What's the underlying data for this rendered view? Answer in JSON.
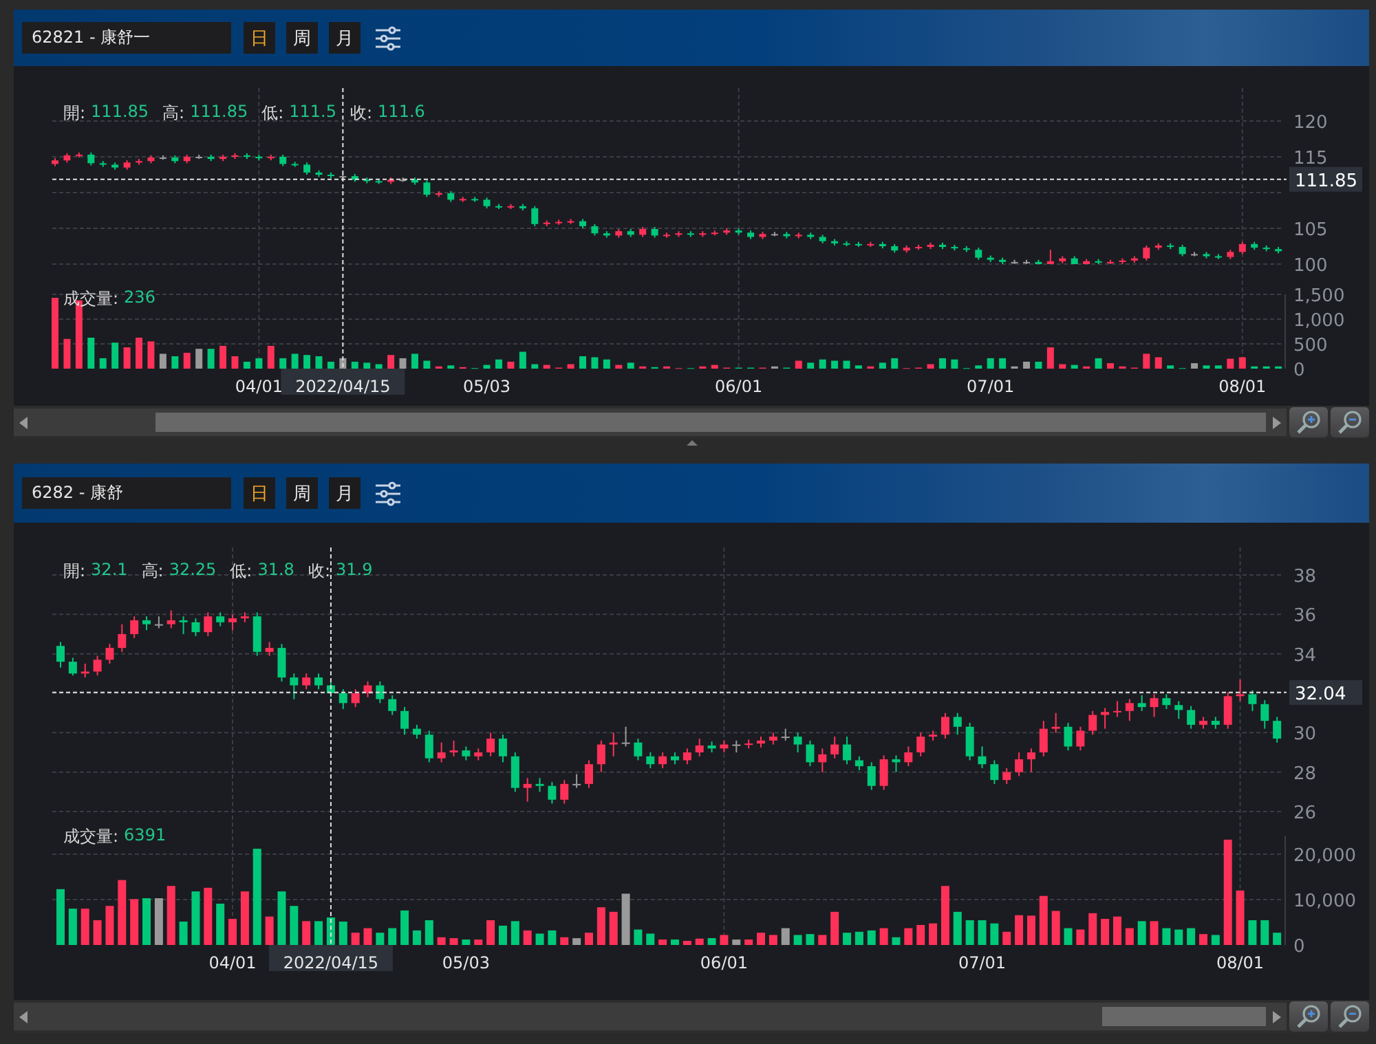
{
  "panels": [
    {
      "symbol": "62821 - 康舒一",
      "periods": [
        {
          "label": "日",
          "selected": true
        },
        {
          "label": "周",
          "selected": false
        },
        {
          "label": "月",
          "selected": false
        }
      ],
      "info": [
        {
          "label": "開:",
          "value": "111.85"
        },
        {
          "label": "高:",
          "value": "111.85"
        },
        {
          "label": "低:",
          "value": "111.5"
        },
        {
          "label": "收:",
          "value": "111.6"
        }
      ],
      "volume_info": {
        "label": "成交量:",
        "value": "236"
      },
      "price_chart": {
        "chart_data": {
          "type": "candlestick",
          "ylim": [
            100,
            120
          ],
          "yticks": [
            100,
            105,
            115,
            120
          ],
          "categories": [
            null,
            null,
            null,
            null,
            null,
            null,
            null,
            null,
            null,
            null,
            null,
            null,
            null,
            null,
            null,
            null,
            null,
            null,
            null,
            null,
            null,
            null,
            null,
            null,
            null,
            null,
            null,
            null,
            null,
            null,
            null,
            null,
            null,
            null,
            null,
            null,
            null,
            null,
            null,
            null,
            null,
            null,
            null,
            null,
            null,
            null,
            null,
            null,
            null,
            null,
            null,
            null,
            null,
            null,
            null,
            null,
            null,
            null,
            null,
            null,
            null,
            null,
            null,
            null,
            null,
            null,
            null,
            null,
            null,
            null,
            null,
            null,
            null,
            null,
            null,
            null,
            null,
            null,
            null,
            null,
            null,
            null,
            null,
            null,
            null,
            null,
            null,
            null,
            null,
            null,
            null,
            null,
            null,
            null,
            null,
            null,
            null,
            null,
            null,
            null,
            null,
            null,
            null
          ],
          "ref_lines": [
            {
              "axis": "y",
              "value": 111.85,
              "label": "111.85"
            }
          ],
          "ohlc": [
            [
              114.0,
              114.8,
              113.7,
              114.5
            ],
            [
              114.5,
              115.5,
              114.2,
              115.2
            ],
            [
              115.2,
              115.6,
              114.9,
              115.3
            ],
            [
              115.3,
              115.6,
              113.8,
              114.1
            ],
            [
              114.1,
              114.4,
              113.6,
              113.9
            ],
            [
              113.9,
              114.2,
              113.2,
              113.5
            ],
            [
              113.5,
              114.5,
              113.2,
              114.2
            ],
            [
              114.2,
              114.7,
              113.9,
              114.4
            ],
            [
              114.4,
              115.2,
              114.1,
              114.9
            ],
            [
              114.9,
              115.2,
              114.6,
              114.9
            ],
            [
              114.9,
              115.2,
              114.1,
              114.4
            ],
            [
              114.4,
              115.3,
              114.1,
              115.0
            ],
            [
              115.0,
              115.3,
              114.7,
              115.0
            ],
            [
              115.0,
              115.3,
              114.4,
              114.7
            ],
            [
              114.7,
              115.3,
              114.4,
              115.0
            ],
            [
              115.0,
              115.5,
              114.7,
              115.2
            ],
            [
              115.2,
              115.5,
              114.7,
              115.0
            ],
            [
              115.0,
              115.3,
              114.5,
              114.8
            ],
            [
              114.8,
              115.3,
              114.5,
              115.0
            ],
            [
              115.0,
              115.3,
              113.7,
              114.0
            ],
            [
              114.0,
              114.3,
              113.6,
              113.9
            ],
            [
              113.9,
              114.2,
              112.5,
              112.8
            ],
            [
              112.8,
              113.1,
              112.2,
              112.5
            ],
            [
              112.5,
              112.8,
              112.0,
              112.3
            ],
            [
              112.3,
              112.6,
              112.0,
              112.3
            ],
            [
              112.3,
              112.6,
              111.5,
              111.8
            ],
            [
              111.8,
              112.1,
              111.3,
              111.6
            ],
            [
              111.6,
              111.9,
              111.2,
              111.5
            ],
            [
              111.5,
              112.1,
              111.2,
              111.8
            ],
            [
              111.8,
              112.1,
              111.5,
              111.8
            ],
            [
              111.8,
              112.1,
              111.1,
              111.4
            ],
            [
              111.4,
              111.7,
              109.4,
              109.7
            ],
            [
              109.7,
              110.2,
              109.4,
              109.9
            ],
            [
              109.9,
              110.2,
              108.7,
              109.0
            ],
            [
              109.0,
              109.4,
              108.7,
              109.1
            ],
            [
              109.1,
              109.4,
              108.7,
              109.0
            ],
            [
              109.0,
              109.3,
              107.8,
              108.1
            ],
            [
              108.1,
              108.4,
              107.7,
              108.0
            ],
            [
              108.0,
              108.4,
              107.7,
              108.1
            ],
            [
              108.1,
              108.4,
              107.5,
              107.8
            ],
            [
              107.8,
              108.1,
              105.3,
              105.6
            ],
            [
              105.6,
              106.1,
              105.3,
              105.8
            ],
            [
              105.8,
              106.2,
              105.5,
              105.9
            ],
            [
              105.9,
              106.3,
              105.6,
              106.0
            ],
            [
              106.0,
              106.3,
              105.0,
              105.3
            ],
            [
              105.3,
              105.6,
              104.0,
              104.3
            ],
            [
              104.3,
              104.6,
              103.7,
              104.0
            ],
            [
              104.0,
              104.9,
              103.7,
              104.6
            ],
            [
              104.6,
              104.9,
              103.8,
              104.1
            ],
            [
              104.1,
              105.2,
              103.8,
              104.9
            ],
            [
              104.9,
              105.2,
              103.7,
              104.0
            ],
            [
              104.0,
              104.4,
              103.7,
              104.1
            ],
            [
              104.1,
              104.6,
              103.8,
              104.3
            ],
            [
              104.3,
              104.6,
              103.8,
              104.1
            ],
            [
              104.1,
              104.6,
              103.8,
              104.3
            ],
            [
              104.3,
              104.7,
              104.0,
              104.4
            ],
            [
              104.4,
              105.0,
              104.1,
              104.7
            ],
            [
              104.7,
              105.0,
              104.1,
              104.4
            ],
            [
              104.4,
              104.7,
              103.5,
              103.8
            ],
            [
              103.8,
              104.5,
              103.5,
              104.2
            ],
            [
              104.2,
              104.5,
              103.9,
              104.2
            ],
            [
              104.2,
              104.5,
              103.6,
              103.9
            ],
            [
              103.9,
              104.4,
              103.6,
              104.1
            ],
            [
              104.1,
              104.4,
              103.5,
              103.8
            ],
            [
              103.8,
              104.1,
              102.9,
              103.2
            ],
            [
              103.2,
              103.5,
              102.6,
              102.9
            ],
            [
              102.9,
              103.2,
              102.5,
              102.8
            ],
            [
              102.8,
              103.1,
              102.4,
              102.7
            ],
            [
              102.7,
              103.1,
              102.4,
              102.8
            ],
            [
              102.8,
              103.1,
              102.2,
              102.5
            ],
            [
              102.5,
              102.8,
              101.6,
              101.9
            ],
            [
              101.9,
              102.6,
              101.6,
              102.3
            ],
            [
              102.3,
              102.7,
              102.0,
              102.4
            ],
            [
              102.4,
              103.0,
              102.1,
              102.7
            ],
            [
              102.7,
              103.0,
              102.1,
              102.4
            ],
            [
              102.4,
              102.7,
              101.9,
              102.2
            ],
            [
              102.2,
              102.5,
              101.7,
              102.0
            ],
            [
              102.0,
              102.3,
              100.6,
              100.9
            ],
            [
              100.9,
              101.2,
              100.3,
              100.6
            ],
            [
              100.6,
              100.9,
              100.0,
              100.3
            ],
            [
              100.3,
              100.6,
              100.0,
              100.3
            ],
            [
              100.3,
              100.6,
              100.0,
              100.3
            ],
            [
              100.3,
              100.6,
              100.0,
              100.0
            ],
            [
              100.0,
              102.0,
              100.0,
              100.4
            ],
            [
              100.4,
              101.1,
              100.1,
              100.8
            ],
            [
              100.8,
              101.1,
              100.0,
              100.0
            ],
            [
              100.0,
              100.7,
              100.0,
              100.4
            ],
            [
              100.4,
              100.7,
              100.0,
              100.2
            ],
            [
              100.2,
              100.6,
              100.0,
              100.3
            ],
            [
              100.3,
              100.8,
              100.0,
              100.5
            ],
            [
              100.5,
              101.1,
              100.2,
              100.8
            ],
            [
              100.8,
              102.6,
              100.5,
              102.3
            ],
            [
              102.3,
              102.9,
              102.0,
              102.6
            ],
            [
              102.6,
              102.9,
              102.1,
              102.4
            ],
            [
              102.4,
              102.7,
              101.1,
              101.4
            ],
            [
              101.4,
              101.7,
              101.1,
              101.4
            ],
            [
              101.4,
              101.7,
              100.8,
              101.1
            ],
            [
              101.1,
              101.4,
              100.7,
              101.0
            ],
            [
              101.0,
              102.0,
              100.7,
              101.7
            ],
            [
              101.7,
              103.1,
              101.4,
              102.8
            ],
            [
              102.8,
              103.1,
              102.0,
              102.3
            ],
            [
              102.3,
              102.6,
              101.8,
              102.1
            ],
            [
              102.1,
              102.4,
              101.5,
              101.8
            ]
          ]
        }
      },
      "volume_chart": {
        "chart_data": {
          "type": "bar",
          "categories": [
            null,
            null,
            null,
            null,
            null,
            null,
            null,
            null,
            null,
            null,
            null,
            null,
            null,
            null,
            null,
            null,
            null,
            "04/01",
            null,
            null,
            null,
            null,
            null,
            null,
            "2022/04/15",
            null,
            null,
            null,
            null,
            null,
            null,
            null,
            null,
            null,
            null,
            null,
            "05/03",
            null,
            null,
            null,
            null,
            null,
            null,
            null,
            null,
            null,
            null,
            null,
            null,
            null,
            null,
            null,
            null,
            null,
            null,
            null,
            null,
            "06/01",
            null,
            null,
            null,
            null,
            null,
            null,
            null,
            null,
            null,
            null,
            null,
            null,
            null,
            null,
            null,
            null,
            null,
            null,
            null,
            null,
            "07/01",
            null,
            null,
            null,
            null,
            null,
            null,
            null,
            null,
            null,
            null,
            null,
            null,
            null,
            null,
            null,
            null,
            null,
            null,
            null,
            null,
            "08/01",
            null,
            null,
            null
          ],
          "ref_lines": [
            {
              "axis": "x",
              "value": "2022/04/15"
            }
          ],
          "yticks": [
            {
              "value": 0,
              "label": "0"
            },
            {
              "value": 500,
              "label": "500"
            },
            {
              "value": 1000,
              "label": "1,000"
            },
            {
              "value": 1500,
              "label": "1,500"
            }
          ],
          "ylim": [
            0,
            1500
          ],
          "values": [
            1430,
            600,
            1380,
            625,
            210,
            525,
            430,
            625,
            550,
            300,
            250,
            320,
            400,
            400,
            460,
            250,
            140,
            210,
            460,
            210,
            300,
            275,
            250,
            140,
            210,
            140,
            120,
            90,
            275,
            210,
            300,
            160,
            45,
            65,
            30,
            10,
            75,
            185,
            140,
            340,
            90,
            75,
            20,
            90,
            250,
            230,
            185,
            75,
            120,
            45,
            30,
            45,
            10,
            10,
            45,
            75,
            20,
            20,
            20,
            20,
            45,
            20,
            160,
            120,
            185,
            160,
            160,
            65,
            45,
            120,
            210,
            10,
            20,
            90,
            210,
            185,
            10,
            65,
            210,
            210,
            45,
            140,
            140,
            430,
            90,
            75,
            45,
            210,
            110,
            45,
            20,
            300,
            230,
            65,
            10,
            110,
            65,
            65,
            200,
            230,
            45,
            45,
            45
          ]
        }
      }
    },
    {
      "symbol": "6282 - 康舒",
      "periods": [
        {
          "label": "日",
          "selected": true
        },
        {
          "label": "周",
          "selected": false
        },
        {
          "label": "月",
          "selected": false
        }
      ],
      "info": [
        {
          "label": "開:",
          "value": "32.1"
        },
        {
          "label": "高:",
          "value": "32.25"
        },
        {
          "label": "低:",
          "value": "31.8"
        },
        {
          "label": "收:",
          "value": "31.9"
        }
      ],
      "volume_info": {
        "label": "成交量:",
        "value": "6391"
      },
      "price_chart": {
        "chart_data": {
          "type": "candlestick",
          "ylim": [
            26,
            38
          ],
          "yticks": [
            26,
            28,
            30,
            34,
            36,
            38
          ],
          "categories": [
            null,
            null,
            null,
            null,
            null,
            null,
            null,
            null,
            null,
            null,
            null,
            null,
            null,
            null,
            null,
            null,
            null,
            null,
            null,
            null,
            null,
            null,
            null,
            null,
            null,
            null,
            null,
            null,
            null,
            null,
            null,
            null,
            null,
            null,
            null,
            null,
            null,
            null,
            null,
            null,
            null,
            null,
            null,
            null,
            null,
            null,
            null,
            null,
            null,
            null,
            null,
            null,
            null,
            null,
            null,
            null,
            null,
            null,
            null,
            null,
            null,
            null,
            null,
            null,
            null,
            null,
            null,
            null,
            null,
            null,
            null,
            null,
            null,
            null,
            null,
            null,
            null,
            null,
            null,
            null,
            null,
            null,
            null,
            null,
            null,
            null,
            null,
            null,
            null,
            null,
            null,
            null,
            null,
            null,
            null,
            null,
            null,
            null,
            null,
            null
          ],
          "ref_lines": [
            {
              "axis": "y",
              "value": 32.04,
              "label": "32.04"
            }
          ],
          "ohlc": [
            [
              34.4,
              34.6,
              33.3,
              33.6
            ],
            [
              33.6,
              33.8,
              32.9,
              33.0
            ],
            [
              33.0,
              33.5,
              32.8,
              33.1
            ],
            [
              33.1,
              33.9,
              32.9,
              33.7
            ],
            [
              33.7,
              34.5,
              33.5,
              34.3
            ],
            [
              34.3,
              35.5,
              34.1,
              35.0
            ],
            [
              35.0,
              35.9,
              34.8,
              35.7
            ],
            [
              35.7,
              35.9,
              35.2,
              35.5
            ],
            [
              35.5,
              35.9,
              35.3,
              35.5
            ],
            [
              35.5,
              36.2,
              35.3,
              35.7
            ],
            [
              35.7,
              35.9,
              35.0,
              35.6
            ],
            [
              35.6,
              35.8,
              34.9,
              35.1
            ],
            [
              35.1,
              36.1,
              34.9,
              35.9
            ],
            [
              35.9,
              36.1,
              35.4,
              35.6
            ],
            [
              35.6,
              36.0,
              35.2,
              35.8
            ],
            [
              35.8,
              36.1,
              35.6,
              35.9
            ],
            [
              35.9,
              36.1,
              33.9,
              34.1
            ],
            [
              34.1,
              34.6,
              33.9,
              34.3
            ],
            [
              34.3,
              34.5,
              32.6,
              32.8
            ],
            [
              32.8,
              33.0,
              31.7,
              32.4
            ],
            [
              32.4,
              33.0,
              32.2,
              32.8
            ],
            [
              32.8,
              33.0,
              32.2,
              32.4
            ],
            [
              32.4,
              32.6,
              31.8,
              32.0
            ],
            [
              32.0,
              32.2,
              31.2,
              31.5
            ],
            [
              31.5,
              32.2,
              31.3,
              32.0
            ],
            [
              32.0,
              32.6,
              31.8,
              32.4
            ],
            [
              32.4,
              32.6,
              31.5,
              31.7
            ],
            [
              31.7,
              31.9,
              30.9,
              31.1
            ],
            [
              31.1,
              31.3,
              29.9,
              30.2
            ],
            [
              30.2,
              30.4,
              29.7,
              29.9
            ],
            [
              29.9,
              30.1,
              28.5,
              28.7
            ],
            [
              28.7,
              29.5,
              28.5,
              29.0
            ],
            [
              29.0,
              29.6,
              28.8,
              29.1
            ],
            [
              29.1,
              29.3,
              28.6,
              28.8
            ],
            [
              28.8,
              29.2,
              28.6,
              29.0
            ],
            [
              29.0,
              30.0,
              28.8,
              29.7
            ],
            [
              29.7,
              29.9,
              28.5,
              28.8
            ],
            [
              28.8,
              29.0,
              27.0,
              27.2
            ],
            [
              27.2,
              27.7,
              26.5,
              27.4
            ],
            [
              27.4,
              27.7,
              27.0,
              27.3
            ],
            [
              27.3,
              27.5,
              26.4,
              26.6
            ],
            [
              26.6,
              27.6,
              26.4,
              27.4
            ],
            [
              27.4,
              27.9,
              27.2,
              27.4
            ],
            [
              27.4,
              28.6,
              27.2,
              28.4
            ],
            [
              28.4,
              29.6,
              28.0,
              29.4
            ],
            [
              29.4,
              30.0,
              28.8,
              29.5
            ],
            [
              29.5,
              30.3,
              29.3,
              29.5
            ],
            [
              29.5,
              29.7,
              28.6,
              28.8
            ],
            [
              28.8,
              29.0,
              28.2,
              28.4
            ],
            [
              28.4,
              29.0,
              28.2,
              28.8
            ],
            [
              28.8,
              29.0,
              28.4,
              28.6
            ],
            [
              28.6,
              29.2,
              28.4,
              29.0
            ],
            [
              29.0,
              29.7,
              28.8,
              29.35
            ],
            [
              29.35,
              29.55,
              29.0,
              29.2
            ],
            [
              29.2,
              29.6,
              29.0,
              29.4
            ],
            [
              29.4,
              29.6,
              29.0,
              29.4
            ],
            [
              29.4,
              29.65,
              29.2,
              29.45
            ],
            [
              29.45,
              29.8,
              29.25,
              29.6
            ],
            [
              29.6,
              30.0,
              29.4,
              29.8
            ],
            [
              29.8,
              30.2,
              29.6,
              29.8
            ],
            [
              29.8,
              30.0,
              29.0,
              29.4
            ],
            [
              29.4,
              29.6,
              28.3,
              28.5
            ],
            [
              28.5,
              29.2,
              28.0,
              28.9
            ],
            [
              28.9,
              29.8,
              28.7,
              29.4
            ],
            [
              29.4,
              29.8,
              28.4,
              28.6
            ],
            [
              28.6,
              28.8,
              28.1,
              28.3
            ],
            [
              28.3,
              28.5,
              27.1,
              27.3
            ],
            [
              27.3,
              28.85,
              27.1,
              28.65
            ],
            [
              28.65,
              28.85,
              28.0,
              28.5
            ],
            [
              28.5,
              29.3,
              28.3,
              29.0
            ],
            [
              29.0,
              30.0,
              28.8,
              29.8
            ],
            [
              29.8,
              30.1,
              29.6,
              29.9
            ],
            [
              29.9,
              31.0,
              29.7,
              30.8
            ],
            [
              30.8,
              31.0,
              29.9,
              30.3
            ],
            [
              30.3,
              30.5,
              28.6,
              28.8
            ],
            [
              28.8,
              29.3,
              28.2,
              28.4
            ],
            [
              28.4,
              28.6,
              27.4,
              27.6
            ],
            [
              27.6,
              28.2,
              27.4,
              28.0
            ],
            [
              28.0,
              29.0,
              27.8,
              28.65
            ],
            [
              28.65,
              29.2,
              28.0,
              29.0
            ],
            [
              29.0,
              30.6,
              28.8,
              30.2
            ],
            [
              30.2,
              31.0,
              30.0,
              30.3
            ],
            [
              30.3,
              30.5,
              29.1,
              29.3
            ],
            [
              29.3,
              30.3,
              29.1,
              30.1
            ],
            [
              30.1,
              31.1,
              29.9,
              30.9
            ],
            [
              30.9,
              31.25,
              30.2,
              31.05
            ],
            [
              31.05,
              31.6,
              30.8,
              31.1
            ],
            [
              31.1,
              31.7,
              30.6,
              31.5
            ],
            [
              31.5,
              31.9,
              31.1,
              31.3
            ],
            [
              31.3,
              31.95,
              30.8,
              31.75
            ],
            [
              31.75,
              31.95,
              31.2,
              31.4
            ],
            [
              31.4,
              31.6,
              30.7,
              31.15
            ],
            [
              31.15,
              31.35,
              30.2,
              30.4
            ],
            [
              30.4,
              30.8,
              30.2,
              30.6
            ],
            [
              30.6,
              30.8,
              30.2,
              30.4
            ],
            [
              30.4,
              32.05,
              30.2,
              31.85
            ],
            [
              31.85,
              32.7,
              31.6,
              31.95
            ],
            [
              31.95,
              32.15,
              31.1,
              31.45
            ],
            [
              31.45,
              31.65,
              30.2,
              30.6
            ],
            [
              30.6,
              30.8,
              29.5,
              29.7
            ]
          ]
        }
      },
      "volume_chart": {
        "chart_data": {
          "type": "bar",
          "categories": [
            null,
            null,
            null,
            null,
            null,
            null,
            null,
            null,
            null,
            null,
            null,
            null,
            null,
            null,
            "04/01",
            null,
            null,
            null,
            null,
            null,
            null,
            null,
            "2022/04/15",
            null,
            null,
            null,
            null,
            null,
            null,
            null,
            null,
            null,
            null,
            "05/03",
            null,
            null,
            null,
            null,
            null,
            null,
            null,
            null,
            null,
            null,
            null,
            null,
            null,
            null,
            null,
            null,
            null,
            null,
            null,
            null,
            "06/01",
            null,
            null,
            null,
            null,
            null,
            null,
            null,
            null,
            null,
            null,
            null,
            null,
            null,
            null,
            null,
            null,
            null,
            null,
            null,
            null,
            "07/01",
            null,
            null,
            null,
            null,
            null,
            null,
            null,
            null,
            null,
            null,
            null,
            null,
            null,
            null,
            null,
            null,
            null,
            null,
            null,
            null,
            "08/01",
            null,
            null,
            null
          ],
          "ref_lines": [
            {
              "axis": "x",
              "value": "2022/04/15"
            }
          ],
          "yticks": [
            {
              "value": 0,
              "label": "0"
            },
            {
              "value": 10000,
              "label": "10,000"
            },
            {
              "value": 20000,
              "label": "20,000"
            }
          ],
          "ylim": [
            0,
            24000
          ],
          "values": [
            12300,
            8000,
            8000,
            5450,
            8600,
            14300,
            10100,
            10300,
            10300,
            13000,
            5150,
            11800,
            12600,
            9100,
            5750,
            11800,
            21200,
            6260,
            11800,
            8600,
            5250,
            5250,
            6060,
            5150,
            2700,
            3700,
            2700,
            3700,
            7600,
            3200,
            5450,
            1700,
            1500,
            1200,
            1200,
            5450,
            4250,
            5250,
            3200,
            2500,
            3200,
            1700,
            1500,
            2700,
            8300,
            7300,
            11300,
            3400,
            2500,
            1200,
            1200,
            900,
            1400,
            1500,
            2200,
            1200,
            1200,
            2700,
            2200,
            3700,
            2200,
            2400,
            2200,
            7300,
            2700,
            2900,
            3200,
            3700,
            1700,
            3700,
            4400,
            4750,
            13000,
            7300,
            5450,
            5450,
            4750,
            2900,
            6560,
            6460,
            10800,
            7500,
            3700,
            3400,
            7000,
            5750,
            6260,
            3700,
            5250,
            5250,
            3700,
            3400,
            3700,
            2400,
            2200,
            23200,
            12000,
            5450,
            5450,
            2700
          ]
        }
      }
    }
  ]
}
